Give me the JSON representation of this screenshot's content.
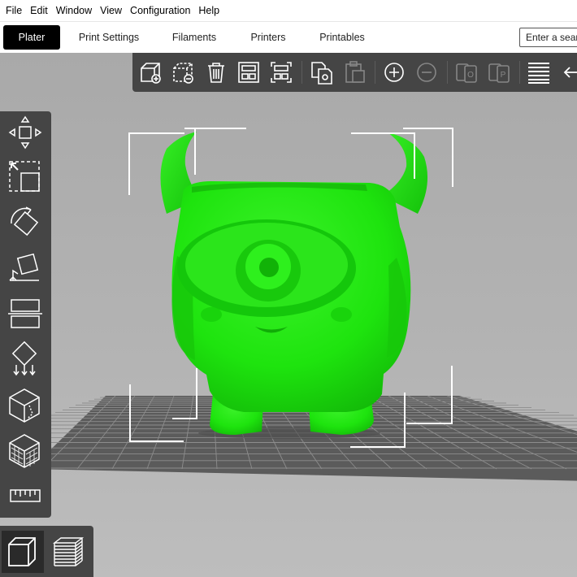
{
  "menu": [
    "File",
    "Edit",
    "Window",
    "View",
    "Configuration",
    "Help"
  ],
  "tabs": [
    {
      "label": "Plater",
      "active": true
    },
    {
      "label": "Print Settings",
      "active": false
    },
    {
      "label": "Filaments",
      "active": false
    },
    {
      "label": "Printers",
      "active": false
    },
    {
      "label": "Printables",
      "active": false
    }
  ],
  "search": {
    "placeholder": "Enter a search term"
  },
  "top_toolbar": [
    {
      "name": "add-object-icon",
      "enabled": true
    },
    {
      "name": "delete-object-icon",
      "enabled": true
    },
    {
      "name": "delete-all-icon",
      "enabled": true
    },
    {
      "name": "arrange-icon",
      "enabled": true
    },
    {
      "name": "arrange-selection-icon",
      "enabled": true
    },
    {
      "name": "copy-icon",
      "enabled": true
    },
    {
      "name": "paste-icon",
      "enabled": false
    },
    {
      "name": "add-instance-icon",
      "enabled": true
    },
    {
      "name": "remove-instance-icon",
      "enabled": false
    },
    {
      "name": "split-to-objects-icon",
      "enabled": false
    },
    {
      "name": "split-to-parts-icon",
      "enabled": false
    },
    {
      "name": "layer-editing-icon",
      "enabled": true
    },
    {
      "name": "undo-icon",
      "enabled": true
    }
  ],
  "left_toolbar": [
    "move-icon",
    "scale-icon",
    "rotate-icon",
    "place-on-face-icon",
    "cut-icon",
    "support-points-icon",
    "seam-painting-icon",
    "fuzzy-skin-icon",
    "measure-icon"
  ],
  "view_toggle": [
    {
      "name": "3d-view-icon",
      "active": true
    },
    {
      "name": "preview-icon",
      "active": false
    }
  ],
  "colors": {
    "model": "#1ee40e",
    "bed": "#5b5b5b",
    "grid": "#9a9a9a",
    "toolbar": "#454545",
    "selection": "#ffffff"
  }
}
